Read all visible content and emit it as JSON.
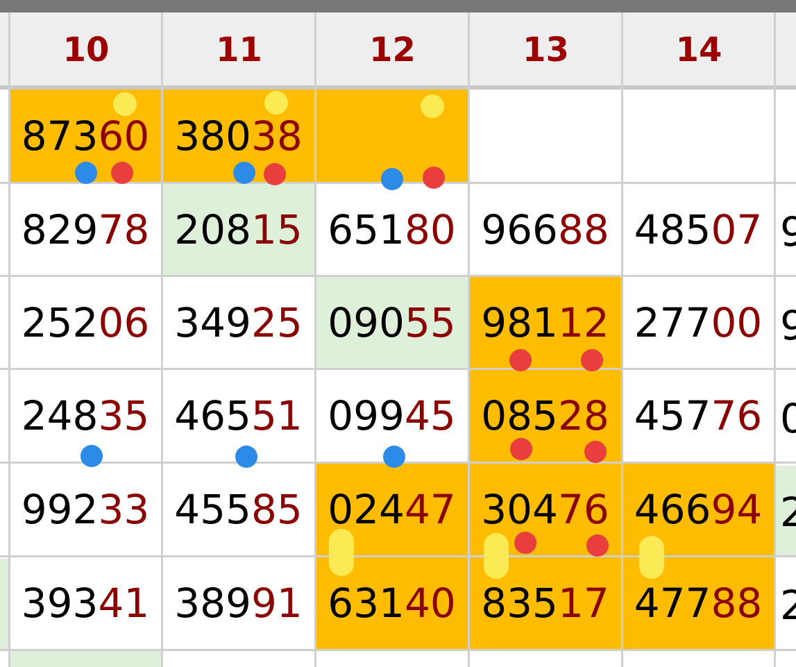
{
  "colors": {
    "header_text": "#9a0000",
    "highlight_orange": "#ffbc00",
    "highlight_green": "#dff0da",
    "dot_blue": "#2b8be6",
    "dot_red": "#e83e3e",
    "marker_yellow": "#fbea54",
    "prefix_text": "#000000",
    "suffix_text": "#8b0000"
  },
  "columns": [
    "10",
    "11",
    "12",
    "13",
    "14"
  ],
  "rows": [
    [
      {
        "pre": "873",
        "suf": "60",
        "bg": "orange"
      },
      {
        "pre": "380",
        "suf": "38",
        "bg": "orange"
      },
      {
        "pre": "",
        "suf": "",
        "bg": "orange"
      },
      {
        "pre": "",
        "suf": "",
        "bg": "white"
      },
      {
        "pre": "",
        "suf": "",
        "bg": "white"
      }
    ],
    [
      {
        "pre": "829",
        "suf": "78",
        "bg": "white"
      },
      {
        "pre": "208",
        "suf": "15",
        "bg": "green"
      },
      {
        "pre": "651",
        "suf": "80",
        "bg": "white"
      },
      {
        "pre": "966",
        "suf": "88",
        "bg": "white"
      },
      {
        "pre": "485",
        "suf": "07",
        "bg": "white"
      }
    ],
    [
      {
        "pre": "252",
        "suf": "06",
        "bg": "white"
      },
      {
        "pre": "349",
        "suf": "25",
        "bg": "white"
      },
      {
        "pre": "090",
        "suf": "55",
        "bg": "green"
      },
      {
        "pre": "981",
        "suf": "12",
        "bg": "orange"
      },
      {
        "pre": "277",
        "suf": "00",
        "bg": "white"
      }
    ],
    [
      {
        "pre": "248",
        "suf": "35",
        "bg": "white"
      },
      {
        "pre": "465",
        "suf": "51",
        "bg": "white"
      },
      {
        "pre": "099",
        "suf": "45",
        "bg": "white"
      },
      {
        "pre": "085",
        "suf": "28",
        "bg": "orange"
      },
      {
        "pre": "457",
        "suf": "76",
        "bg": "white"
      }
    ],
    [
      {
        "pre": "992",
        "suf": "33",
        "bg": "white"
      },
      {
        "pre": "455",
        "suf": "85",
        "bg": "white"
      },
      {
        "pre": "024",
        "suf": "47",
        "bg": "orange"
      },
      {
        "pre": "304",
        "suf": "76",
        "bg": "orange"
      },
      {
        "pre": "466",
        "suf": "94",
        "bg": "orange"
      }
    ],
    [
      {
        "pre": "393",
        "suf": "41",
        "bg": "white"
      },
      {
        "pre": "389",
        "suf": "91",
        "bg": "white"
      },
      {
        "pre": "631",
        "suf": "40",
        "bg": "orange"
      },
      {
        "pre": "835",
        "suf": "17",
        "bg": "orange"
      },
      {
        "pre": "477",
        "suf": "88",
        "bg": "orange"
      }
    ]
  ],
  "partial_column_digits": [
    "9",
    "9",
    "0",
    "2",
    "2"
  ]
}
